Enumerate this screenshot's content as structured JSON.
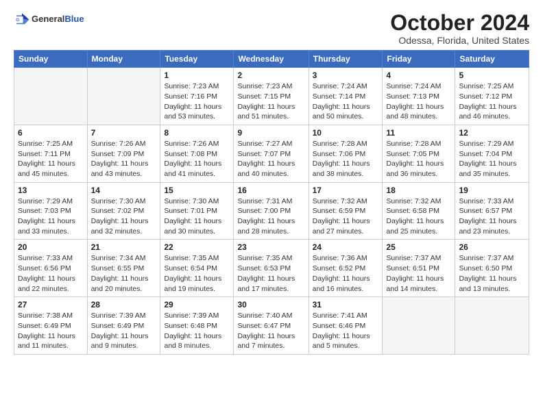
{
  "header": {
    "logo_general": "General",
    "logo_blue": "Blue",
    "title": "October 2024",
    "location": "Odessa, Florida, United States"
  },
  "days_of_week": [
    "Sunday",
    "Monday",
    "Tuesday",
    "Wednesday",
    "Thursday",
    "Friday",
    "Saturday"
  ],
  "weeks": [
    [
      {
        "day": "",
        "empty": true
      },
      {
        "day": "",
        "empty": true
      },
      {
        "day": "1",
        "sunrise": "Sunrise: 7:23 AM",
        "sunset": "Sunset: 7:16 PM",
        "daylight": "Daylight: 11 hours and 53 minutes."
      },
      {
        "day": "2",
        "sunrise": "Sunrise: 7:23 AM",
        "sunset": "Sunset: 7:15 PM",
        "daylight": "Daylight: 11 hours and 51 minutes."
      },
      {
        "day": "3",
        "sunrise": "Sunrise: 7:24 AM",
        "sunset": "Sunset: 7:14 PM",
        "daylight": "Daylight: 11 hours and 50 minutes."
      },
      {
        "day": "4",
        "sunrise": "Sunrise: 7:24 AM",
        "sunset": "Sunset: 7:13 PM",
        "daylight": "Daylight: 11 hours and 48 minutes."
      },
      {
        "day": "5",
        "sunrise": "Sunrise: 7:25 AM",
        "sunset": "Sunset: 7:12 PM",
        "daylight": "Daylight: 11 hours and 46 minutes."
      }
    ],
    [
      {
        "day": "6",
        "sunrise": "Sunrise: 7:25 AM",
        "sunset": "Sunset: 7:11 PM",
        "daylight": "Daylight: 11 hours and 45 minutes."
      },
      {
        "day": "7",
        "sunrise": "Sunrise: 7:26 AM",
        "sunset": "Sunset: 7:09 PM",
        "daylight": "Daylight: 11 hours and 43 minutes."
      },
      {
        "day": "8",
        "sunrise": "Sunrise: 7:26 AM",
        "sunset": "Sunset: 7:08 PM",
        "daylight": "Daylight: 11 hours and 41 minutes."
      },
      {
        "day": "9",
        "sunrise": "Sunrise: 7:27 AM",
        "sunset": "Sunset: 7:07 PM",
        "daylight": "Daylight: 11 hours and 40 minutes."
      },
      {
        "day": "10",
        "sunrise": "Sunrise: 7:28 AM",
        "sunset": "Sunset: 7:06 PM",
        "daylight": "Daylight: 11 hours and 38 minutes."
      },
      {
        "day": "11",
        "sunrise": "Sunrise: 7:28 AM",
        "sunset": "Sunset: 7:05 PM",
        "daylight": "Daylight: 11 hours and 36 minutes."
      },
      {
        "day": "12",
        "sunrise": "Sunrise: 7:29 AM",
        "sunset": "Sunset: 7:04 PM",
        "daylight": "Daylight: 11 hours and 35 minutes."
      }
    ],
    [
      {
        "day": "13",
        "sunrise": "Sunrise: 7:29 AM",
        "sunset": "Sunset: 7:03 PM",
        "daylight": "Daylight: 11 hours and 33 minutes."
      },
      {
        "day": "14",
        "sunrise": "Sunrise: 7:30 AM",
        "sunset": "Sunset: 7:02 PM",
        "daylight": "Daylight: 11 hours and 32 minutes."
      },
      {
        "day": "15",
        "sunrise": "Sunrise: 7:30 AM",
        "sunset": "Sunset: 7:01 PM",
        "daylight": "Daylight: 11 hours and 30 minutes."
      },
      {
        "day": "16",
        "sunrise": "Sunrise: 7:31 AM",
        "sunset": "Sunset: 7:00 PM",
        "daylight": "Daylight: 11 hours and 28 minutes."
      },
      {
        "day": "17",
        "sunrise": "Sunrise: 7:32 AM",
        "sunset": "Sunset: 6:59 PM",
        "daylight": "Daylight: 11 hours and 27 minutes."
      },
      {
        "day": "18",
        "sunrise": "Sunrise: 7:32 AM",
        "sunset": "Sunset: 6:58 PM",
        "daylight": "Daylight: 11 hours and 25 minutes."
      },
      {
        "day": "19",
        "sunrise": "Sunrise: 7:33 AM",
        "sunset": "Sunset: 6:57 PM",
        "daylight": "Daylight: 11 hours and 23 minutes."
      }
    ],
    [
      {
        "day": "20",
        "sunrise": "Sunrise: 7:33 AM",
        "sunset": "Sunset: 6:56 PM",
        "daylight": "Daylight: 11 hours and 22 minutes."
      },
      {
        "day": "21",
        "sunrise": "Sunrise: 7:34 AM",
        "sunset": "Sunset: 6:55 PM",
        "daylight": "Daylight: 11 hours and 20 minutes."
      },
      {
        "day": "22",
        "sunrise": "Sunrise: 7:35 AM",
        "sunset": "Sunset: 6:54 PM",
        "daylight": "Daylight: 11 hours and 19 minutes."
      },
      {
        "day": "23",
        "sunrise": "Sunrise: 7:35 AM",
        "sunset": "Sunset: 6:53 PM",
        "daylight": "Daylight: 11 hours and 17 minutes."
      },
      {
        "day": "24",
        "sunrise": "Sunrise: 7:36 AM",
        "sunset": "Sunset: 6:52 PM",
        "daylight": "Daylight: 11 hours and 16 minutes."
      },
      {
        "day": "25",
        "sunrise": "Sunrise: 7:37 AM",
        "sunset": "Sunset: 6:51 PM",
        "daylight": "Daylight: 11 hours and 14 minutes."
      },
      {
        "day": "26",
        "sunrise": "Sunrise: 7:37 AM",
        "sunset": "Sunset: 6:50 PM",
        "daylight": "Daylight: 11 hours and 13 minutes."
      }
    ],
    [
      {
        "day": "27",
        "sunrise": "Sunrise: 7:38 AM",
        "sunset": "Sunset: 6:49 PM",
        "daylight": "Daylight: 11 hours and 11 minutes."
      },
      {
        "day": "28",
        "sunrise": "Sunrise: 7:39 AM",
        "sunset": "Sunset: 6:49 PM",
        "daylight": "Daylight: 11 hours and 9 minutes."
      },
      {
        "day": "29",
        "sunrise": "Sunrise: 7:39 AM",
        "sunset": "Sunset: 6:48 PM",
        "daylight": "Daylight: 11 hours and 8 minutes."
      },
      {
        "day": "30",
        "sunrise": "Sunrise: 7:40 AM",
        "sunset": "Sunset: 6:47 PM",
        "daylight": "Daylight: 11 hours and 7 minutes."
      },
      {
        "day": "31",
        "sunrise": "Sunrise: 7:41 AM",
        "sunset": "Sunset: 6:46 PM",
        "daylight": "Daylight: 11 hours and 5 minutes."
      },
      {
        "day": "",
        "empty": true
      },
      {
        "day": "",
        "empty": true
      }
    ]
  ]
}
